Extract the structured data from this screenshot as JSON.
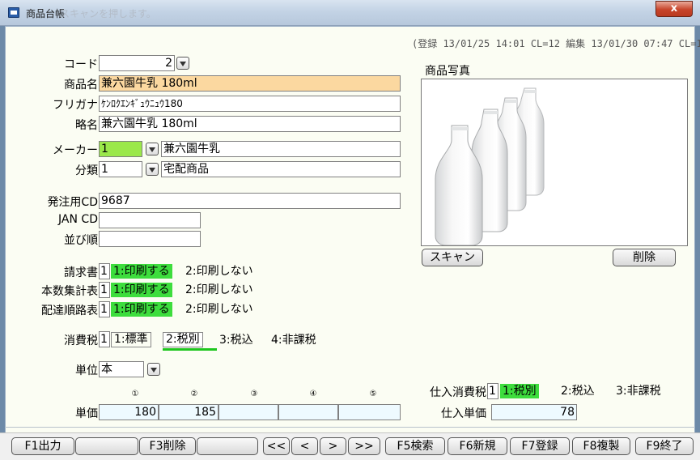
{
  "window": {
    "title": "商品台帳",
    "faded_title": "スキャンを押します。",
    "close_label": "x"
  },
  "meta": "(登録 13/01/25 14:01 CL=12  編集 13/01/30 07:47 CL=12)",
  "form": {
    "code": {
      "label": "コード",
      "value": "2"
    },
    "name": {
      "label": "商品名",
      "value": "兼六園牛乳 180ml"
    },
    "kana": {
      "label": "フリガナ",
      "value": "ｹﾝﾛｸｴﾝｷﾞｭｳﾆｭｳ180"
    },
    "short_name": {
      "label": "略名",
      "value": "兼六園牛乳 180ml"
    },
    "maker": {
      "label": "メーカー",
      "code": "1",
      "name": "兼六園牛乳"
    },
    "category": {
      "label": "分類",
      "code": "1",
      "name": "宅配商品"
    },
    "order_cd": {
      "label": "発注用CD",
      "value": "9687"
    },
    "jan_cd": {
      "label": "JAN CD",
      "value": ""
    },
    "sort": {
      "label": "並び順",
      "value": ""
    },
    "invoice": {
      "label": "請求書",
      "code": "1",
      "opt1": "1:印刷する",
      "opt2": "2:印刷しない"
    },
    "count_table": {
      "label": "本数集計表",
      "code": "1",
      "opt1": "1:印刷する",
      "opt2": "2:印刷しない"
    },
    "route_table": {
      "label": "配達順路表",
      "code": "1",
      "opt1": "1:印刷する",
      "opt2": "2:印刷しない"
    },
    "tax": {
      "label": "消費税",
      "code": "1",
      "opt1": "1:標準",
      "opt2": "2:税別",
      "opt3": "3:税込",
      "opt4": "4:非課税"
    },
    "unit": {
      "label": "単位",
      "value": "本"
    },
    "price": {
      "label": "単価",
      "markers": [
        "①",
        "②",
        "③",
        "④",
        "⑤"
      ],
      "values": [
        "180",
        "185",
        "",
        "",
        ""
      ]
    },
    "purchase_tax": {
      "label": "仕入消費税",
      "code": "1",
      "opt1": "1:税別",
      "opt2": "2:税込",
      "opt3": "3:非課税"
    },
    "purchase_price": {
      "label": "仕入単価",
      "value": "78"
    }
  },
  "photo": {
    "label": "商品写真",
    "scan_button": "スキャン",
    "delete_button": "削除"
  },
  "footer": {
    "f1": "F1出力",
    "blank1": "",
    "f3": "F3削除",
    "blank2": "",
    "first": "<<",
    "prev": "<",
    "next": ">",
    "last": ">>",
    "f5": "F5検索",
    "f6": "F6新規",
    "f7": "F7登録",
    "f8": "F8複製",
    "f9": "F9終了"
  },
  "colors": {
    "name_field_bg": "#fbd8a0",
    "maker_code_bg": "#9be84a",
    "selected_green": "#3ddd3d",
    "form_bg": "#fbfdf3"
  }
}
